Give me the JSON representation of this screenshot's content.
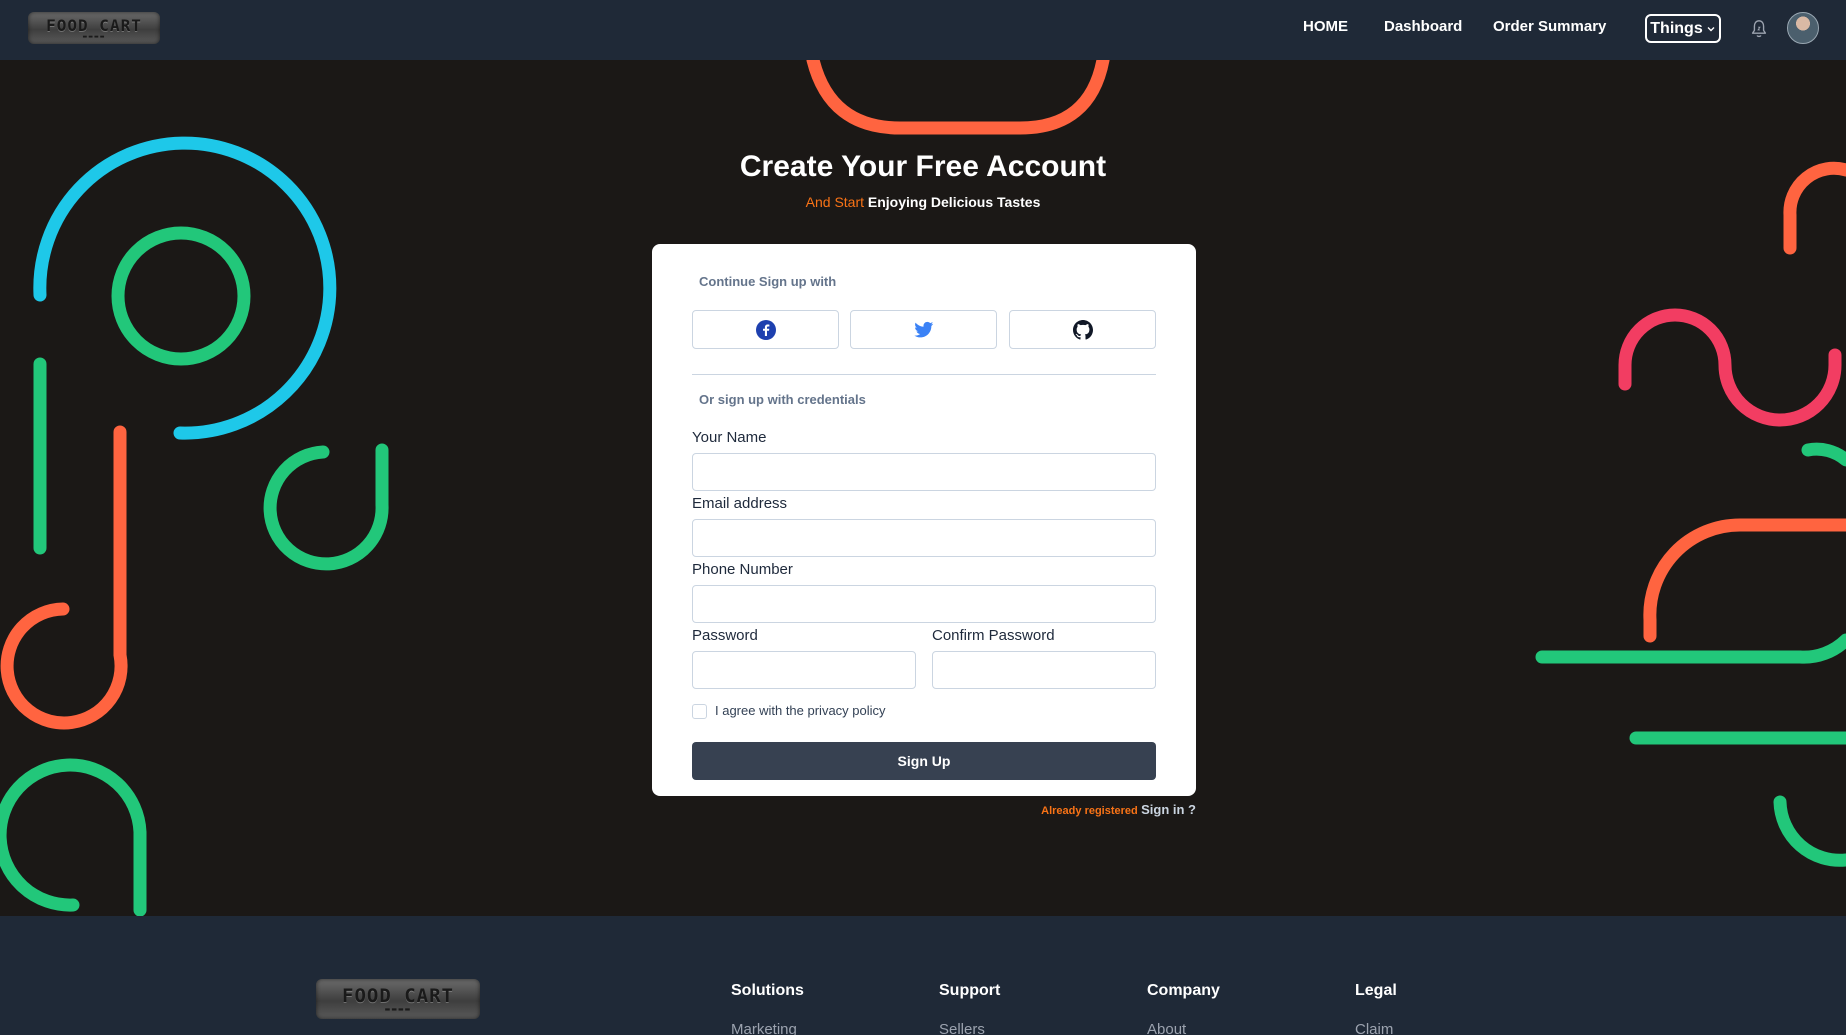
{
  "navbar": {
    "logo_text": "FOOD CART",
    "links": [
      "HOME",
      "Dashboard",
      "Order Summary"
    ],
    "dropdown_label": "Things",
    "icons": [
      "bell-icon",
      "avatar"
    ]
  },
  "hero": {
    "title": "Create Your Free Account",
    "subtitle_accent": "And Start",
    "subtitle_rest": "Enjoying Delicious Tastes"
  },
  "form": {
    "social_heading": "Continue Sign up with",
    "social_buttons": [
      "facebook-icon",
      "twitter-icon",
      "github-icon"
    ],
    "credentials_heading": "Or sign up with credentials",
    "fields": {
      "name": {
        "label": "Your Name",
        "value": ""
      },
      "email": {
        "label": "Email address",
        "value": ""
      },
      "phone": {
        "label": "Phone Number",
        "value": ""
      },
      "password": {
        "label": "Password",
        "value": ""
      },
      "confirm_password": {
        "label": "Confirm Password",
        "value": ""
      }
    },
    "agree_label": "I agree with the privacy policy",
    "agree_checked": false,
    "submit_label": "Sign Up",
    "signin_prompt": "Already registered",
    "signin_link": "Sign in ?"
  },
  "footer": {
    "logo_text": "FOOD CART",
    "columns": [
      {
        "title": "Solutions",
        "first_item": "Marketing"
      },
      {
        "title": "Support",
        "first_item": "Sellers"
      },
      {
        "title": "Company",
        "first_item": "About"
      },
      {
        "title": "Legal",
        "first_item": "Claim"
      }
    ]
  },
  "colors": {
    "navbar_bg": "#1f2937",
    "page_bg": "#1b1816",
    "accent_orange": "#f97316",
    "deco_blue": "#1ec8e9",
    "deco_green": "#22c77a",
    "deco_orange": "#ff6440",
    "deco_pink": "#f23d62",
    "button_dark": "#374151"
  }
}
